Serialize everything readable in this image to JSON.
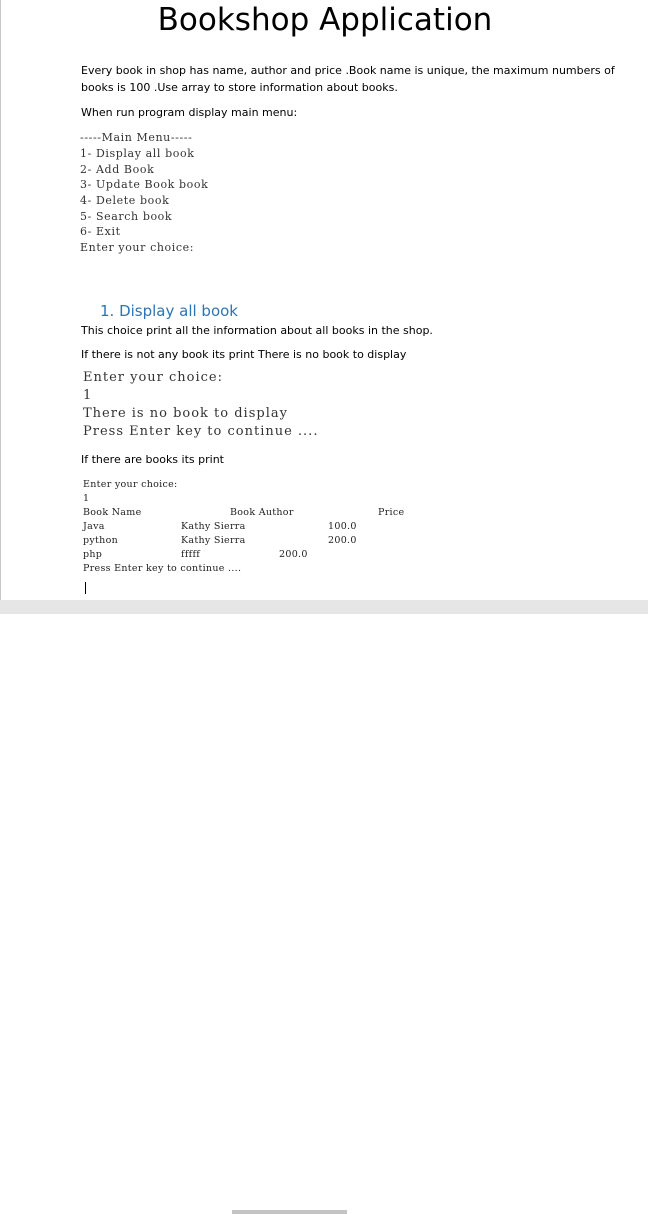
{
  "title": "Bookshop Application",
  "intro": {
    "line1": "Every book in shop has name, author and price .Book name is unique, the maximum numbers of",
    "line2": "books is 100 .Use array to store information  about books.",
    "run_line": "When run program display main menu:"
  },
  "menu": {
    "lines": [
      "-----Main Menu-----",
      "1- Display all book",
      "2- Add Book",
      "3- Update Book book",
      "4- Delete book",
      "5- Search book",
      "6- Exit",
      "Enter your choice:"
    ]
  },
  "section1": {
    "heading": "1. Display all book",
    "desc": "This choice print all the information about all books in the shop.",
    "no_books_text": "If there is not any book its print There is no book to display",
    "no_books_console": [
      "Enter your choice:",
      "1",
      "There is no book to display",
      "Press Enter key to continue ...."
    ],
    "books_text": "If there are books its print",
    "books_console": {
      "prompt": "Enter your choice:",
      "input": "1",
      "headers": [
        "Book Name",
        "Book Author",
        "Price"
      ],
      "rows": [
        [
          "Java",
          "Kathy Sierra",
          "100.0"
        ],
        [
          "python",
          "Kathy Sierra",
          "200.0"
        ],
        [
          "php",
          "fffff",
          "200.0"
        ]
      ],
      "footer": "Press Enter key to continue ...."
    }
  }
}
